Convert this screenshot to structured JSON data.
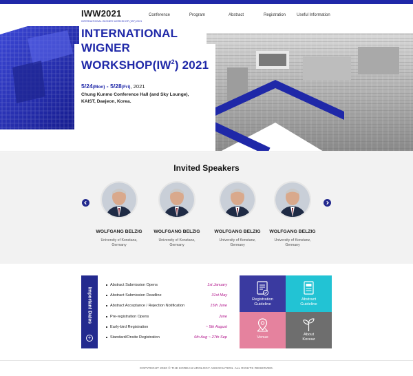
{
  "brand": {
    "title": "IWW2021",
    "subtitle": "INTERNATIONAL WIGNER WORKSHOP (IW²) 2021",
    "accent": "#1f28a8"
  },
  "nav": {
    "items": [
      "Conference",
      "Program",
      "Abstract",
      "Registration",
      "Useful Information"
    ]
  },
  "hero": {
    "title_line1": "INTERNATIONAL",
    "title_line2": "WIGNER",
    "title_line3_prefix": "WORKSHOP(IW",
    "title_line3_sup": "2",
    "title_line3_suffix": ") 2021",
    "date_start": "5/24",
    "date_start_day": "(Mon)",
    "date_sep": " - ",
    "date_end": "5/28",
    "date_end_day": "(Fri)",
    "date_year": ", 2021",
    "venue_line1": "Chung Kunmo Conference Hall (and Sky Lounge),",
    "venue_line2": "KAIST, Daejeon, Korea."
  },
  "speakers": {
    "title": "Invited Speakers",
    "items": [
      {
        "name": "WOLFGANG BELZIG",
        "aff1": "University of Konstanz,",
        "aff2": "Germany"
      },
      {
        "name": "WOLFGANG BELZIG",
        "aff1": "University of Konstanz,",
        "aff2": "Germany"
      },
      {
        "name": "WOLFGANG BELZIG",
        "aff1": "University of Konstanz,",
        "aff2": "Germany"
      },
      {
        "name": "WOLFGANG BELZIG",
        "aff1": "University of Konstanz,",
        "aff2": "Germany"
      }
    ]
  },
  "important_dates": {
    "label": "Important Dates",
    "rows": [
      {
        "label": "Abstract Submission Opens",
        "date": "1st January"
      },
      {
        "label": "Abstract Submission Deadline",
        "date": "31st May"
      },
      {
        "label": "Abstract Acceptance / Rejection Notification",
        "date": "15th June"
      },
      {
        "label": "Pre-registration Opens",
        "date": "June"
      },
      {
        "label": "Early-bird Registration",
        "date": "~ 5th August"
      },
      {
        "label": "Standard/Onsite Registration",
        "date": "6th Aug ~ 27th Sep"
      }
    ],
    "date_color": "#b0128a"
  },
  "tiles": {
    "registration": {
      "line1": "Registration",
      "line2": "Guideline",
      "color": "#3a3aa0",
      "icon": "document-check-icon"
    },
    "abstract": {
      "line1": "Abstract",
      "line2": "Guideline",
      "color": "#22c3d4",
      "icon": "document-list-icon"
    },
    "venue": {
      "line1": "Venue",
      "color": "#e5829e",
      "icon": "map-pin-icon"
    },
    "about": {
      "line1": "About",
      "line2": "Koreaz",
      "color": "#6e6e6e",
      "icon": "sprout-icon"
    }
  },
  "footer": {
    "copyright": "COPYRIGHT 2020 © THE KOREAN UROLOGY ASSOCIATION. ALL RIGHTS RESERVED."
  }
}
